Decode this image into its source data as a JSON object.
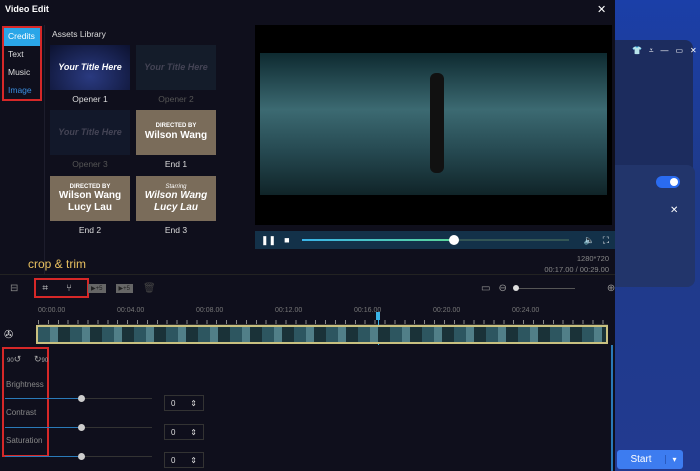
{
  "window": {
    "title": "Video Edit",
    "close": "✕"
  },
  "bg_app": {
    "controls": [
      "👕",
      "⩡",
      "—",
      "▭",
      "✕"
    ],
    "close": "✕",
    "start_label": "Start",
    "start_dropdown": "▾"
  },
  "categories": [
    {
      "label": "Credits"
    },
    {
      "label": "Text"
    },
    {
      "label": "Music"
    },
    {
      "label": "Image"
    }
  ],
  "assets": {
    "heading": "Assets Library",
    "items": [
      {
        "label": "Opener 1",
        "thumb": [
          "Your Title Here"
        ]
      },
      {
        "label": "Opener 2",
        "thumb": [
          "Your Title Here"
        ]
      },
      {
        "label": "Opener 3",
        "thumb": [
          "Your Title Here"
        ]
      },
      {
        "label": "End 1",
        "thumb": [
          "DIRECTED BY",
          "Wilson Wang"
        ]
      },
      {
        "label": "End 2",
        "thumb": [
          "DIRECTED BY",
          "Wilson Wang",
          "Lucy Lau"
        ]
      },
      {
        "label": "End 3",
        "thumb": [
          "Starring",
          "Wilson Wang",
          "Lucy Lau"
        ]
      }
    ]
  },
  "player": {
    "progress": 0.57,
    "resolution": "1280*720",
    "time": "00:17.00 / 00:29.00"
  },
  "annotation": "crop & trim",
  "toolbar": {
    "btn1": "▶+5",
    "btn2": "▶+5"
  },
  "timeline": {
    "ticks": [
      "00:00.00",
      "00:04.00",
      "00:08.00",
      "00:12.00",
      "00:16.00",
      "00:20.00",
      "00:24.00"
    ],
    "playhead_seconds": 17
  },
  "properties": {
    "rotate_left": "90",
    "rotate_right": "90",
    "brightness": {
      "label": "Brightness",
      "value": "0"
    },
    "contrast": {
      "label": "Contrast",
      "value": "0"
    },
    "saturation": {
      "label": "Saturation",
      "value": "0"
    },
    "spinner": "⇕"
  }
}
